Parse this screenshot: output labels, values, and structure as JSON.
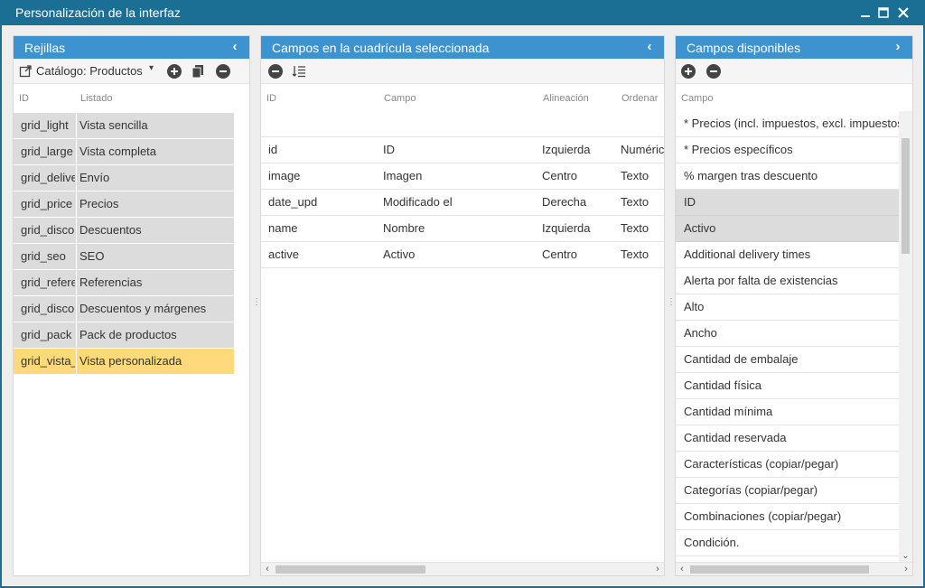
{
  "window": {
    "title": "Personalización de la interfaz"
  },
  "left_panel": {
    "title": "Rejillas",
    "catalog_label": "Catálogo: Productos",
    "col_id": "ID",
    "col_listado": "Listado",
    "rows": [
      {
        "id": "grid_light",
        "listado": "Vista sencilla"
      },
      {
        "id": "grid_large",
        "listado": "Vista completa"
      },
      {
        "id": "grid_delivery",
        "listado": "Envío"
      },
      {
        "id": "grid_price",
        "listado": "Precios"
      },
      {
        "id": "grid_discount",
        "listado": "Descuentos"
      },
      {
        "id": "grid_seo",
        "listado": "SEO"
      },
      {
        "id": "grid_reference",
        "listado": "Referencias"
      },
      {
        "id": "grid_discount_margin",
        "listado": "Descuentos y márgenes"
      },
      {
        "id": "grid_pack",
        "listado": "Pack de productos"
      },
      {
        "id": "grid_vista_personalizada",
        "listado": "Vista personalizada"
      }
    ]
  },
  "middle_panel": {
    "title": "Campos en la cuadrícula seleccionada",
    "col_id": "ID",
    "col_campo": "Campo",
    "col_alineacion": "Alineación",
    "col_ordenar": "Ordenar",
    "rows": [
      {
        "id": "id",
        "campo": "ID",
        "alineacion": "Izquierda",
        "ordenar": "Numérico"
      },
      {
        "id": "image",
        "campo": "Imagen",
        "alineacion": "Centro",
        "ordenar": "Texto"
      },
      {
        "id": "date_upd",
        "campo": "Modificado el",
        "alineacion": "Derecha",
        "ordenar": "Texto"
      },
      {
        "id": "name",
        "campo": "Nombre",
        "alineacion": "Izquierda",
        "ordenar": "Texto"
      },
      {
        "id": "active",
        "campo": "Activo",
        "alineacion": "Centro",
        "ordenar": "Texto"
      }
    ]
  },
  "right_panel": {
    "title": "Campos disponibles",
    "col_campo": "Campo",
    "rows": [
      "* Precios (incl. impuestos, excl. impuestos, i",
      "* Precios específicos",
      "% margen tras descuento",
      "ID",
      "Activo",
      "Additional delivery times",
      "Alerta por falta de existencias",
      "Alto",
      "Ancho",
      "Cantidad de embalaje",
      "Cantidad física",
      "Cantidad mínima",
      "Cantidad reservada",
      "Características (copiar/pegar)",
      "Categorías (copiar/pegar)",
      "Combinaciones (copiar/pegar)",
      "Condición."
    ]
  },
  "colors": {
    "accent": "#3d93cf",
    "selected": "#ffd97a",
    "gray_row": "#dcdcdc",
    "window": "#1b6f95"
  }
}
